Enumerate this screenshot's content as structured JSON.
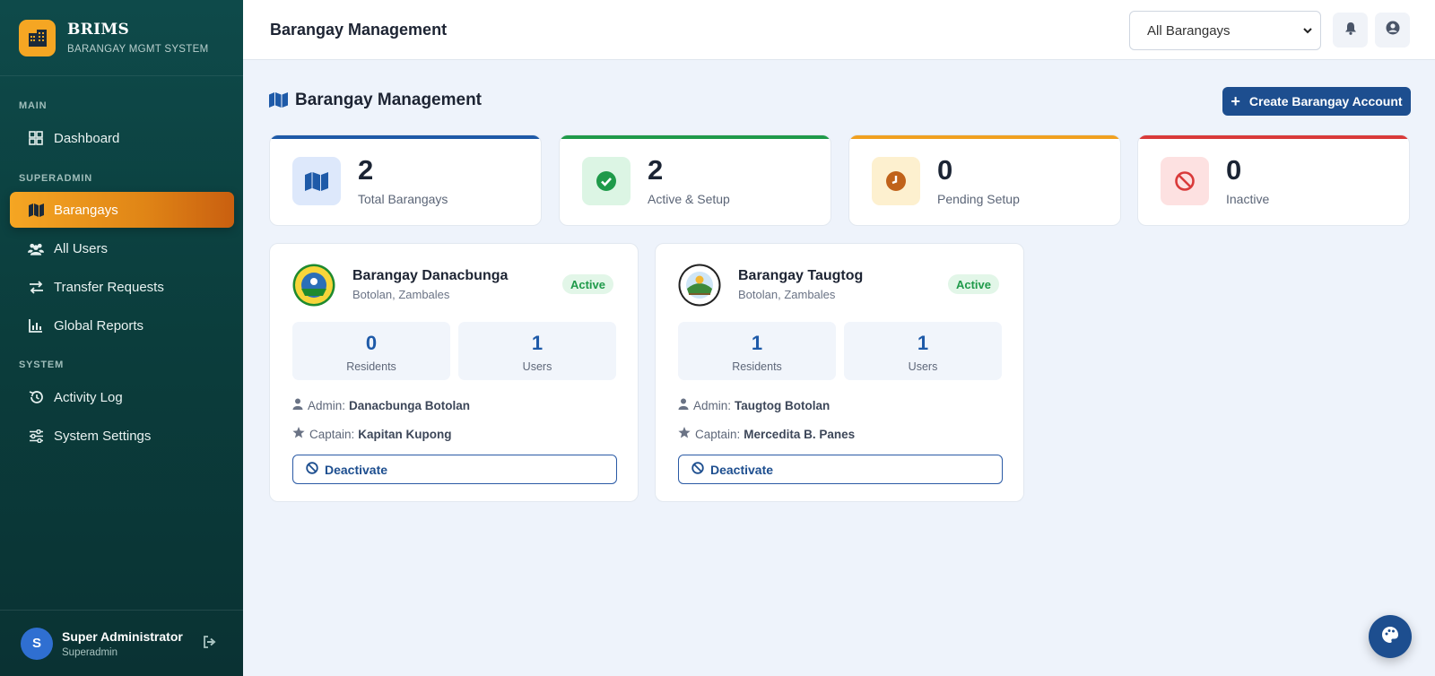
{
  "brand": {
    "name": "BRIMS",
    "subtitle": "BARANGAY MGMT SYSTEM",
    "logo_icon": "building-icon",
    "accent": "#f5a623"
  },
  "sidebar": {
    "sections": [
      {
        "label": "MAIN"
      },
      {
        "label": "SUPERADMIN"
      },
      {
        "label": "SYSTEM"
      }
    ],
    "items": [
      {
        "label": "Dashboard",
        "icon": "grid-icon",
        "active": false
      },
      {
        "label": "Barangays",
        "icon": "map-icon",
        "active": true
      },
      {
        "label": "All Users",
        "icon": "users-icon",
        "active": false
      },
      {
        "label": "Transfer Requests",
        "icon": "transfer-icon",
        "active": false
      },
      {
        "label": "Global Reports",
        "icon": "chart-icon",
        "active": false
      },
      {
        "label": "Activity Log",
        "icon": "history-icon",
        "active": false
      },
      {
        "label": "System Settings",
        "icon": "sliders-icon",
        "active": false
      }
    ],
    "user": {
      "initial": "S",
      "name": "Super Administrator",
      "role": "Superadmin"
    }
  },
  "topbar": {
    "title": "Barangay Management",
    "filter_value": "All Barangays"
  },
  "main": {
    "title": "Barangay Management",
    "create_label": "Create Barangay Account",
    "stats": [
      {
        "value": "2",
        "label": "Total Barangays",
        "color": "#1e5aa8",
        "icon": "map-icon"
      },
      {
        "value": "2",
        "label": "Active & Setup",
        "color": "#1f9a4a",
        "icon": "check-circle-icon"
      },
      {
        "value": "0",
        "label": "Pending Setup",
        "color": "#f0a020",
        "icon": "clock-icon"
      },
      {
        "value": "0",
        "label": "Inactive",
        "color": "#d93a3a",
        "icon": "ban-icon"
      }
    ],
    "barangays": [
      {
        "name": "Barangay Danacbunga",
        "location": "Botolan, Zambales",
        "status": "Active",
        "residents": "0",
        "residents_label": "Residents",
        "users": "1",
        "users_label": "Users",
        "admin_label": "Admin:",
        "admin": "Danacbunga Botolan",
        "captain_label": "Captain:",
        "captain": "Kapitan Kupong",
        "action": "Deactivate"
      },
      {
        "name": "Barangay Taugtog",
        "location": "Botolan, Zambales",
        "status": "Active",
        "residents": "1",
        "residents_label": "Residents",
        "users": "1",
        "users_label": "Users",
        "admin_label": "Admin:",
        "admin": "Taugtog Botolan",
        "captain_label": "Captain:",
        "captain": "Mercedita B. Panes",
        "action": "Deactivate"
      }
    ]
  }
}
